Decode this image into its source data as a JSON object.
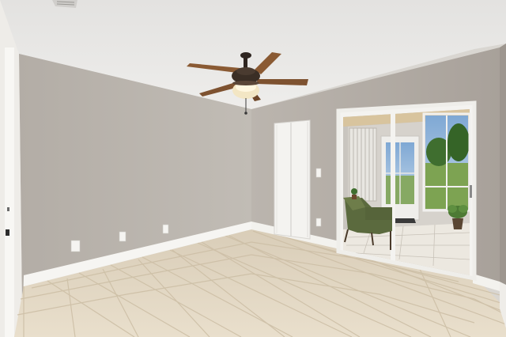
{
  "scene": {
    "subject": "empty-room",
    "elements": [
      "textured-ceiling",
      "ceiling-fan-with-light",
      "closet-door",
      "sliding-glass-door",
      "sunroom-chair",
      "potted-plant",
      "tile-floor",
      "white-baseboards",
      "light-switches",
      "wall-outlets"
    ]
  },
  "colors": {
    "wall": "#b7b1aa",
    "wall_right": "#aca59e",
    "ceiling": "#e8e7e5",
    "floor": "#e3d8c4",
    "trim": "#f6f5f2",
    "fan_blade": "#8a5a33",
    "fan_body": "#3a2e25",
    "sky": "#8fb4d9",
    "lawn": "#7da352"
  }
}
